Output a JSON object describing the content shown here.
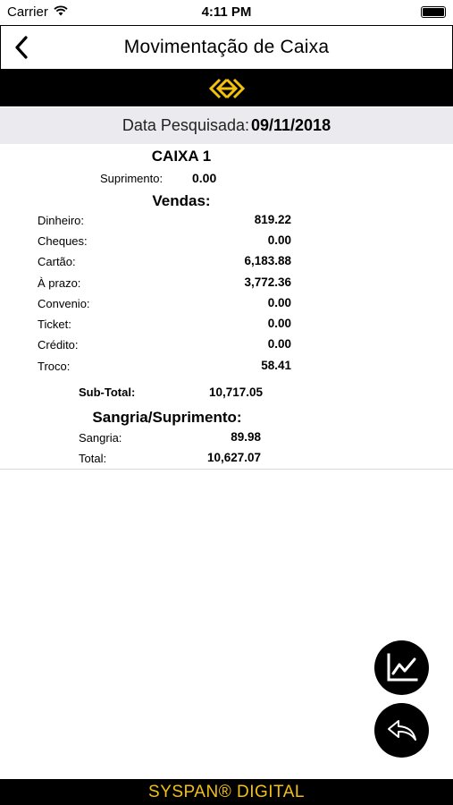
{
  "status_bar": {
    "carrier": "Carrier",
    "time": "4:11 PM",
    "wifi_icon": "wifi-icon",
    "battery_level": 1.0
  },
  "nav": {
    "back_icon": "chevron-left-icon",
    "title": "Movimentação de Caixa"
  },
  "brand": {
    "logo_icon": "syspan-logo",
    "color": "#f2c011"
  },
  "search": {
    "date_label": "Data Pesquisada:",
    "date_value": "09/11/2018"
  },
  "report": {
    "caixa_title": "CAIXA 1",
    "suprimento_label": "Suprimento:",
    "suprimento_value": "0.00",
    "vendas_title": "Vendas:",
    "vendas": [
      {
        "label": "Dinheiro:",
        "value": "819.22"
      },
      {
        "label": "Cheques:",
        "value": "0.00"
      },
      {
        "label": "Cartão:",
        "value": "6,183.88"
      },
      {
        "label": "À prazo:",
        "value": "3,772.36"
      },
      {
        "label": "Convenio:",
        "value": "0.00"
      },
      {
        "label": "Ticket:",
        "value": "0.00"
      },
      {
        "label": "Crédito:",
        "value": "0.00"
      },
      {
        "label": "Troco:",
        "value": "58.41"
      }
    ],
    "subtotal_label": "Sub-Total:",
    "subtotal_value": "10,717.05",
    "sangria_title": "Sangria/Suprimento:",
    "sangria_rows": [
      {
        "label": "Sangria:",
        "value": "89.98"
      },
      {
        "label": "Total:",
        "value": "10,627.07"
      }
    ]
  },
  "actions": {
    "chart_icon": "line-chart-icon",
    "reply_icon": "reply-icon"
  },
  "footer": {
    "brand_text": "SYSPAN® DIGITAL"
  }
}
